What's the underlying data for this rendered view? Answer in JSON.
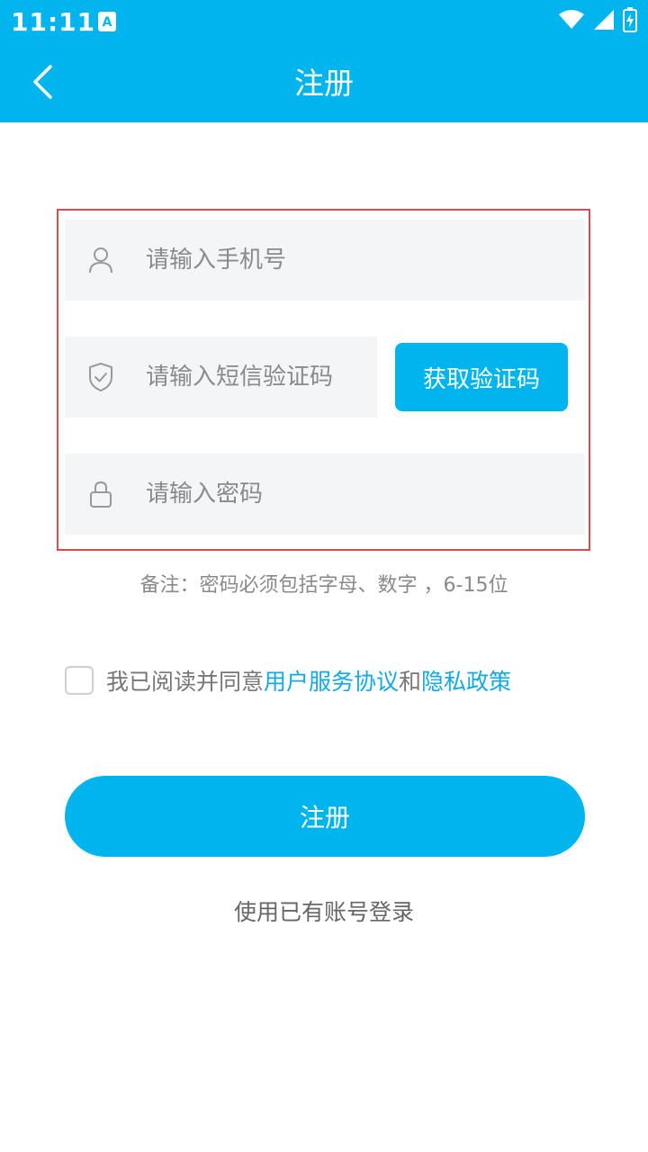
{
  "status_bar": {
    "time": "11:11"
  },
  "header": {
    "title": "注册"
  },
  "form": {
    "phone_placeholder": "请输入手机号",
    "code_placeholder": "请输入短信验证码",
    "get_code_label": "获取验证码",
    "password_placeholder": "请输入密码"
  },
  "note": "备注：密码必须包括字母、数字 ，6-15位",
  "agreement": {
    "prefix": "我已阅读并同意",
    "terms_link": "用户服务协议",
    "conjunction": "和",
    "privacy_link": "隐私政策",
    "checked": false
  },
  "submit_label": "注册",
  "login_link": "使用已有账号登录",
  "colors": {
    "accent": "#00b5ee",
    "highlight_border": "#d94a4a",
    "link": "#12a9e4"
  },
  "icons": [
    "back-arrow-icon",
    "user-icon",
    "shield-check-icon",
    "lock-icon",
    "wifi-icon",
    "signal-icon",
    "battery-icon"
  ]
}
